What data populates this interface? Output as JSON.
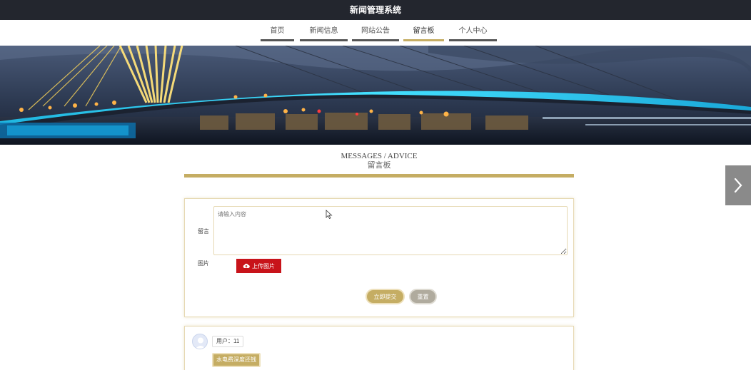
{
  "app": {
    "title": "新闻管理系统"
  },
  "nav": {
    "items": [
      {
        "label": "首页"
      },
      {
        "label": "新闻信息"
      },
      {
        "label": "网站公告"
      },
      {
        "label": "留言板"
      },
      {
        "label": "个人中心"
      }
    ],
    "active_index": 3
  },
  "section": {
    "title_en": "MESSAGES / ADVICE",
    "title_zh": "留言板"
  },
  "form": {
    "message_label": "留言",
    "message_placeholder": "请输入内容",
    "image_label": "图片",
    "upload_label": "上传图片",
    "submit_label": "立即提交",
    "reset_label": "重置"
  },
  "messages": [
    {
      "user": "用户：11",
      "content": "水电费深度还钱"
    }
  ],
  "colors": {
    "accent": "#c5ad63",
    "danger": "#c8131a",
    "topbar": "#23262e"
  },
  "icons": {
    "upload": "cloud-upload-icon",
    "next": "chevron-right-icon",
    "cursor": "mouse-cursor-icon"
  }
}
